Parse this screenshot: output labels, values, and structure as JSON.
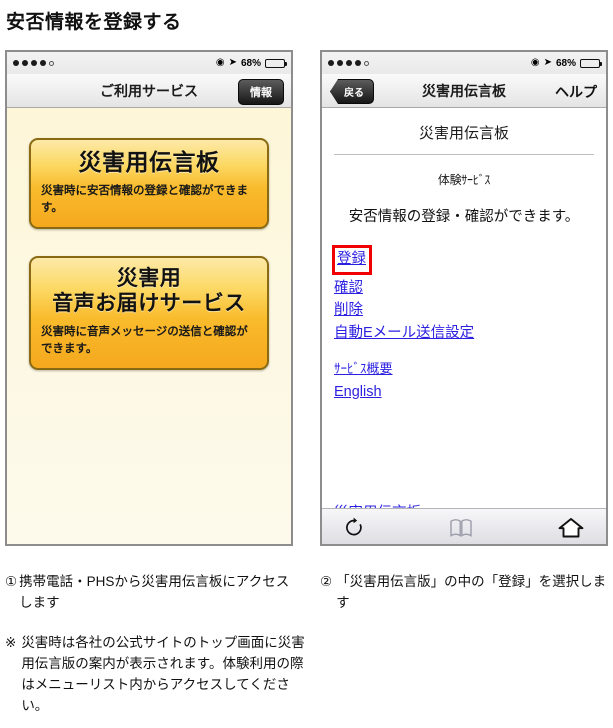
{
  "page": {
    "title": "安否情報を登録する"
  },
  "phone_one": {
    "statusbar": {
      "signal_dots_filled": 4,
      "signal_dots_total": 5,
      "location_icon": "location-icon",
      "nav_arrow_icon": "navigation-arrow-icon",
      "battery_percent": "68%",
      "battery_fill_ratio": 0.68
    },
    "navbar": {
      "title": "ご利用サービス",
      "info_button": "情報"
    },
    "services": [
      {
        "heading": "災害用伝言板",
        "heading_lines": [
          "災害用伝言板"
        ],
        "description": "災害時に安否情報の登録と確認ができます。"
      },
      {
        "heading": "災害用音声お届けサービス",
        "heading_lines": [
          "災害用",
          "音声お届けサービス"
        ],
        "description": "災害時に音声メッセージの送信と確認ができます。"
      }
    ]
  },
  "phone_two": {
    "statusbar": {
      "signal_dots_filled": 4,
      "signal_dots_total": 5,
      "location_icon": "location-icon",
      "nav_arrow_icon": "navigation-arrow-icon",
      "battery_percent": "68%",
      "battery_fill_ratio": 0.68
    },
    "navbar": {
      "back_button": "戻る",
      "title": "災害用伝言板",
      "help_button": "ヘルプ"
    },
    "content": {
      "page_title": "災害用伝言板",
      "subtitle": "体験ｻｰﾋﾞｽ",
      "description": "安否情報の登録・確認ができます。",
      "links_primary": [
        {
          "label": "登録",
          "highlighted": true
        },
        {
          "label": "確認",
          "highlighted": false
        },
        {
          "label": "削除",
          "highlighted": false
        },
        {
          "label": "自動Eメール送信設定",
          "highlighted": false
        }
      ],
      "links_secondary": [
        {
          "label": "ｻｰﾋﾞｽ概要"
        },
        {
          "label": "English"
        }
      ],
      "cut_off_link": "災害用伝言板",
      "highlight_color": "#f00000",
      "link_color": "#2b1fe0"
    },
    "toolbar": {
      "reload_icon": "reload-icon",
      "bookmarks_icon": "bookmarks-icon",
      "home_icon": "home-icon"
    }
  },
  "captions": {
    "step_one": {
      "marker": "①",
      "text": "携帯電話・PHSから災害用伝言板にアクセスします"
    },
    "step_two": {
      "marker": "②",
      "text": "「災害用伝言版」の中の「登録」を選択します"
    },
    "note": {
      "marker": "※",
      "text": "災害時は各社の公式サイトのトップ画面に災害用伝言版の案内が表示されます。体験利用の際はメニューリスト内からアクセスしてください。"
    }
  }
}
